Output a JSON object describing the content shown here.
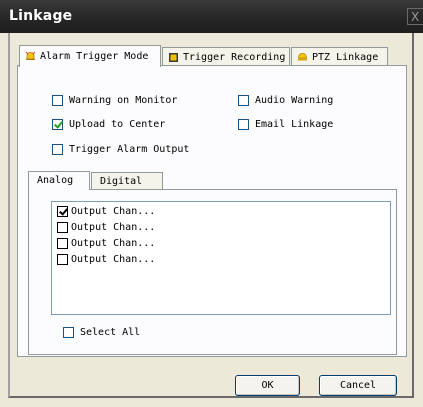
{
  "window": {
    "title": "Linkage",
    "close_glyph": "X"
  },
  "tabs": [
    {
      "label": "Alarm Trigger Mode",
      "icon": "alarm-bell-icon",
      "color": "#e8b000"
    },
    {
      "label": "Trigger Recording",
      "icon": "recording-icon",
      "color": "#d4a000"
    },
    {
      "label": "PTZ Linkage",
      "icon": "ptz-dome-icon",
      "color": "#f0b800"
    }
  ],
  "options": {
    "warning_on_monitor": {
      "label": "Warning on Monitor",
      "checked": false
    },
    "audio_warning": {
      "label": "Audio Warning",
      "checked": false
    },
    "upload_to_center": {
      "label": "Upload to Center",
      "checked": true
    },
    "email_linkage": {
      "label": "Email Linkage",
      "checked": false
    },
    "trigger_alarm_output": {
      "label": "Trigger Alarm Output",
      "checked": false
    }
  },
  "output_tabs": [
    {
      "label": "Analog"
    },
    {
      "label": "Digital"
    }
  ],
  "outputs": [
    {
      "label": "Output Chan...",
      "checked": true
    },
    {
      "label": "Output Chan...",
      "checked": false
    },
    {
      "label": "Output Chan...",
      "checked": false
    },
    {
      "label": "Output Chan...",
      "checked": false
    }
  ],
  "select_all": {
    "label": "Select All",
    "checked": false
  },
  "buttons": {
    "ok": "OK",
    "cancel": "Cancel"
  },
  "colors": {
    "titlebar": "#262626",
    "dialog_bg": "#ece9d8",
    "check_mark": "#21a121"
  }
}
